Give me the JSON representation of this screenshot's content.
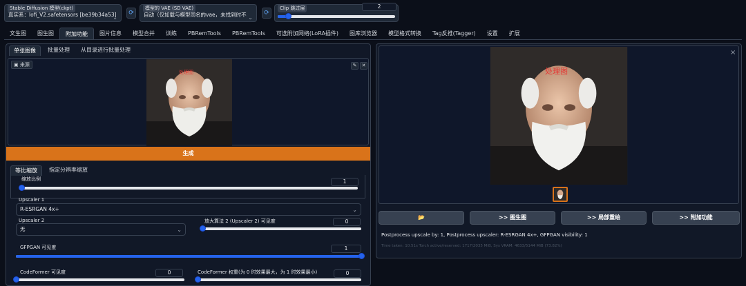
{
  "top": {
    "checkpoint_label": "Stable Diffusion 模型(ckpt)",
    "checkpoint_value": "真实系：lofi_V2.safetensors [be39b34a53]",
    "vae_label": "模型的 VAE (SD VAE)",
    "vae_value": "自动（仅如载与模型同名的vae，未找到时不加",
    "clip_label": "Clip 跳过层",
    "clip_value": "2",
    "clip_fraction": 0.09,
    "refresh_glyph": "⟳"
  },
  "tabs": [
    {
      "label": "文生图"
    },
    {
      "label": "图生图"
    },
    {
      "label": "附加功能"
    },
    {
      "label": "图片信息"
    },
    {
      "label": "模型合并"
    },
    {
      "label": "训练"
    },
    {
      "label": "PBRemTools"
    },
    {
      "label": "PBRemTools"
    },
    {
      "label": "可选附加网络(LoRA插件)"
    },
    {
      "label": "图库浏览器"
    },
    {
      "label": "模型格式转换"
    },
    {
      "label": "Tag反推(Tagger)"
    },
    {
      "label": "设置"
    },
    {
      "label": "扩展"
    }
  ],
  "left": {
    "subtabs": [
      "单张图像",
      "批量处理",
      "从目录进行批量处理"
    ],
    "source_label": "来源",
    "source_icon": "image-icon",
    "watermark": "处理图",
    "generate": "生成",
    "scale_tabs": [
      "等比缩放",
      "指定分辨率缩放"
    ],
    "scale_label": "缩放比例",
    "scale_value": "1",
    "scale_fraction": 0.0,
    "upscaler1_label": "Upscaler 1",
    "upscaler1_value": "R-ESRGAN 4x+",
    "upscaler2_label": "Upscaler 2",
    "upscaler2_value": "无",
    "upscaler2_vis_label": "放大算法 2 (Upscaler 2) 可见度",
    "upscaler2_vis_value": "0",
    "upscaler2_vis_fraction": 0.0,
    "gfpgan_label": "GFPGAN 可见度",
    "gfpgan_value": "1",
    "gfpgan_fraction": 1.0,
    "codeformer_label": "CodeFormer 可见度",
    "codeformer_value": "0",
    "codeformer_fraction": 0.0,
    "codeformer_w_label": "CodeFormer 权重(为 0 时效果最大，为 1 时效果最小)",
    "codeformer_w_value": "0",
    "codeformer_w_fraction": 0.0
  },
  "right": {
    "close_glyph": "×",
    "watermark": "处理图",
    "buttons": [
      "📂",
      ">> 图生图",
      ">> 局部重绘",
      ">> 附加功能"
    ],
    "info": "Postprocess upscale by: 1, Postprocess upscaler: R-ESRGAN 4x+, GFPGAN visibility: 1",
    "timing": "Time taken: 10.51s  Torch active/reserved: 1717/2035 MiB, Sys VRAM: 4633/5144 MiB (73.82%)"
  },
  "colors": {
    "accent_orange": "#d9731a",
    "slider_blue": "#2563eb",
    "bg": "#0b0f19",
    "panel": "#111827"
  }
}
